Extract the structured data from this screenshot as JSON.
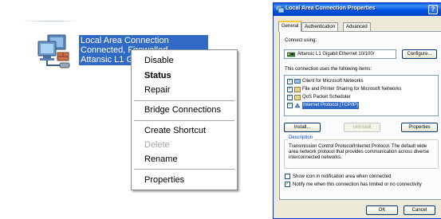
{
  "connection": {
    "lines": [
      "Local Area Connection",
      "Connected, Firewalled",
      "Attansic L1 G"
    ],
    "icon": "network-connection-icon"
  },
  "context_menu": {
    "items": [
      {
        "label": "Disable",
        "bold": false,
        "disabled": false
      },
      {
        "label": "Status",
        "bold": true,
        "disabled": false
      },
      {
        "label": "Repair",
        "bold": false,
        "disabled": false
      },
      {
        "label": "Bridge Connections",
        "bold": false,
        "disabled": false
      },
      {
        "label": "Create Shortcut",
        "bold": false,
        "disabled": false
      },
      {
        "label": "Delete",
        "bold": false,
        "disabled": true
      },
      {
        "label": "Rename",
        "bold": false,
        "disabled": false
      },
      {
        "label": "Properties",
        "bold": false,
        "disabled": false
      }
    ]
  },
  "dialog": {
    "title": "Local Area Connection Properties",
    "help_label": "?",
    "tabs": [
      "General",
      "Authentication",
      "Advanced"
    ],
    "active_tab": "General",
    "connect_using_label": "Connect using:",
    "adapter_name": "Attansic L1 Gigabit Ethernet 10/100/",
    "configure_label": "Configure...",
    "components_label": "This connection uses the following items:",
    "components": [
      {
        "label": "Client for Microsoft Networks",
        "checked": true,
        "selected": false
      },
      {
        "label": "File and Printer Sharing for Microsoft Networks",
        "checked": true,
        "selected": false
      },
      {
        "label": "QoS Packet Scheduler",
        "checked": true,
        "selected": false
      },
      {
        "label": "Internet Protocol (TCP/IP)",
        "checked": true,
        "selected": true
      }
    ],
    "install_label": "Install...",
    "uninstall_label": "Uninstall",
    "properties_label": "Properties",
    "description_label": "Description",
    "description_text": "Transmission Control Protocol/Internet Protocol. The default wide area network protocol that provides communication across diverse interconnected networks.",
    "show_icon_label": "Show icon in notification area when connected",
    "show_icon_checked": false,
    "notify_label": "Notify me when this connection has limited or no connectivity",
    "notify_checked": true,
    "ok_label": "OK",
    "cancel_label": "Cancel"
  },
  "colors": {
    "selection": "#316ac5",
    "xp_title": "#0054e3",
    "dialog_face": "#ece9d8"
  }
}
